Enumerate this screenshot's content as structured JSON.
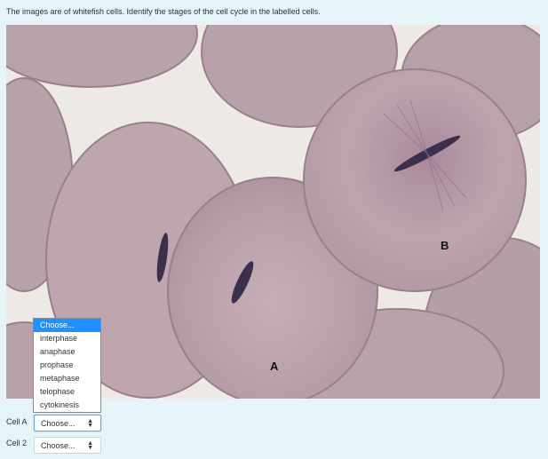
{
  "question": "The images are of whitefish cells. Identify the stages of the cell cycle in the labelled cells.",
  "image": {
    "label_a": "A",
    "label_b": "B"
  },
  "dropdown_options": [
    "Choose...",
    "interphase",
    "anaphase",
    "prophase",
    "metaphase",
    "telophase",
    "cytokinesis"
  ],
  "rows": [
    {
      "label": "Cell A",
      "value": "Choose..."
    },
    {
      "label": "Cell 2",
      "value": "Choose..."
    }
  ],
  "colors": {
    "highlight": "#1e90ff",
    "background": "#e6f3f9"
  }
}
